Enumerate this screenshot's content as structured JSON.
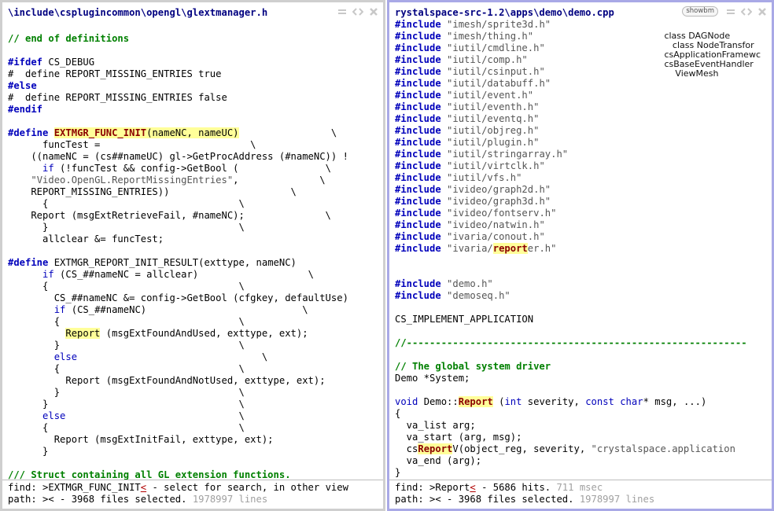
{
  "left": {
    "title": "\\include\\csplugincommon\\opengl\\glextmanager.h",
    "lines": [
      [],
      [
        {
          "t": "// end of definitions",
          "c": "cm"
        }
      ],
      [],
      [
        {
          "t": "#ifdef",
          "c": "pp"
        },
        {
          "t": " CS_DEBUG"
        }
      ],
      [
        {
          "t": "#  define REPORT_MISSING_ENTRIES true"
        }
      ],
      [
        {
          "t": "#else",
          "c": "pp"
        }
      ],
      [
        {
          "t": "#  define REPORT_MISSING_ENTRIES false"
        }
      ],
      [
        {
          "t": "#endif",
          "c": "pp"
        }
      ],
      [],
      [
        {
          "t": "#define",
          "c": "pp"
        },
        {
          "t": " "
        },
        {
          "t": "EXTMGR_FUNC_INIT",
          "c": "hlo"
        },
        {
          "t": "(nameNC, nameUC)",
          "c": "hl"
        },
        {
          "t": "                \\"
        }
      ],
      [
        {
          "t": "      funcTest =                          \\"
        }
      ],
      [
        {
          "t": "    ((nameNC = (cs##nameUC) gl->GetProcAddress (#nameNC)) !"
        }
      ],
      [
        {
          "t": "      "
        },
        {
          "t": "if",
          "c": "kw"
        },
        {
          "t": " (!funcTest && config->GetBool (               \\"
        }
      ],
      [
        {
          "t": "    "
        },
        {
          "t": "\"Video.OpenGL.ReportMissingEntries\"",
          "c": "str"
        },
        {
          "t": ",              \\"
        }
      ],
      [
        {
          "t": "    REPORT_MISSING_ENTRIES))                     \\"
        }
      ],
      [
        {
          "t": "      {                                 \\"
        }
      ],
      [
        {
          "t": "    Report (msgExtRetrieveFail, #nameNC);              \\"
        }
      ],
      [
        {
          "t": "      }                                 \\"
        }
      ],
      [
        {
          "t": "      allclear &= funcTest;"
        }
      ],
      [],
      [
        {
          "t": "#define",
          "c": "pp"
        },
        {
          "t": " EXTMGR_REPORT_INIT_RESULT(exttype, nameNC)"
        }
      ],
      [
        {
          "t": "      "
        },
        {
          "t": "if",
          "c": "kw"
        },
        {
          "t": " (CS_##nameNC = allclear)                   \\"
        }
      ],
      [
        {
          "t": "      {                                 \\"
        }
      ],
      [
        {
          "t": "        CS_##nameNC &= config->GetBool (cfgkey, defaultUse)"
        }
      ],
      [
        {
          "t": "        "
        },
        {
          "t": "if",
          "c": "kw"
        },
        {
          "t": " (CS_##nameNC)                           \\"
        }
      ],
      [
        {
          "t": "        {                               \\"
        }
      ],
      [
        {
          "t": "          "
        },
        {
          "t": "Report",
          "c": "hl"
        },
        {
          "t": " (msgExtFoundAndUsed, exttype, ext);"
        }
      ],
      [
        {
          "t": "        }                               \\"
        }
      ],
      [
        {
          "t": "        "
        },
        {
          "t": "else",
          "c": "kw"
        },
        {
          "t": "                                \\"
        }
      ],
      [
        {
          "t": "        {                               \\"
        }
      ],
      [
        {
          "t": "          Report (msgExtFoundAndNotUsed, exttype, ext);"
        }
      ],
      [
        {
          "t": "        }                               \\"
        }
      ],
      [
        {
          "t": "      }                                 \\"
        }
      ],
      [
        {
          "t": "      "
        },
        {
          "t": "else",
          "c": "kw"
        },
        {
          "t": "                              \\"
        }
      ],
      [
        {
          "t": "      {                                 \\"
        }
      ],
      [
        {
          "t": "        Report (msgExtInitFail, exttype, ext);"
        }
      ],
      [
        {
          "t": "      }"
        }
      ],
      [],
      [
        {
          "t": "/// Struct containing all GL extension functions.",
          "c": "cm"
        }
      ]
    ],
    "status": {
      "find_prefix": "find: >EXTMGR_FUNC_INIT",
      "find_caret": "<",
      "find_rest": " - select for search, in other view",
      "path_text": "path: >< - 3968 files selected. ",
      "path_count": "1978997 lines"
    }
  },
  "right": {
    "title": "rystalspace-src-1.2\\apps\\demo\\demo.cpp",
    "showbm": "showbm",
    "outline": [
      "class DAGNode",
      "   class NodeTransfor",
      "csApplicationFramewc",
      "csBaseEventHandler",
      "    ViewMesh"
    ],
    "lines": [
      [
        {
          "t": "#include",
          "c": "pp"
        },
        {
          "t": " "
        },
        {
          "t": "\"imesh/sprite3d.h\"",
          "c": "str"
        }
      ],
      [
        {
          "t": "#include",
          "c": "pp"
        },
        {
          "t": " "
        },
        {
          "t": "\"imesh/thing.h\"",
          "c": "str"
        }
      ],
      [
        {
          "t": "#include",
          "c": "pp"
        },
        {
          "t": " "
        },
        {
          "t": "\"iutil/cmdline.h\"",
          "c": "str"
        }
      ],
      [
        {
          "t": "#include",
          "c": "pp"
        },
        {
          "t": " "
        },
        {
          "t": "\"iutil/comp.h\"",
          "c": "str"
        }
      ],
      [
        {
          "t": "#include",
          "c": "pp"
        },
        {
          "t": " "
        },
        {
          "t": "\"iutil/csinput.h\"",
          "c": "str"
        }
      ],
      [
        {
          "t": "#include",
          "c": "pp"
        },
        {
          "t": " "
        },
        {
          "t": "\"iutil/databuff.h\"",
          "c": "str"
        }
      ],
      [
        {
          "t": "#include",
          "c": "pp"
        },
        {
          "t": " "
        },
        {
          "t": "\"iutil/event.h\"",
          "c": "str"
        }
      ],
      [
        {
          "t": "#include",
          "c": "pp"
        },
        {
          "t": " "
        },
        {
          "t": "\"iutil/eventh.h\"",
          "c": "str"
        }
      ],
      [
        {
          "t": "#include",
          "c": "pp"
        },
        {
          "t": " "
        },
        {
          "t": "\"iutil/eventq.h\"",
          "c": "str"
        }
      ],
      [
        {
          "t": "#include",
          "c": "pp"
        },
        {
          "t": " "
        },
        {
          "t": "\"iutil/objreg.h\"",
          "c": "str"
        }
      ],
      [
        {
          "t": "#include",
          "c": "pp"
        },
        {
          "t": " "
        },
        {
          "t": "\"iutil/plugin.h\"",
          "c": "str"
        }
      ],
      [
        {
          "t": "#include",
          "c": "pp"
        },
        {
          "t": " "
        },
        {
          "t": "\"iutil/stringarray.h\"",
          "c": "str"
        }
      ],
      [
        {
          "t": "#include",
          "c": "pp"
        },
        {
          "t": " "
        },
        {
          "t": "\"iutil/virtclk.h\"",
          "c": "str"
        }
      ],
      [
        {
          "t": "#include",
          "c": "pp"
        },
        {
          "t": " "
        },
        {
          "t": "\"iutil/vfs.h\"",
          "c": "str"
        }
      ],
      [
        {
          "t": "#include",
          "c": "pp"
        },
        {
          "t": " "
        },
        {
          "t": "\"ivideo/graph2d.h\"",
          "c": "str"
        }
      ],
      [
        {
          "t": "#include",
          "c": "pp"
        },
        {
          "t": " "
        },
        {
          "t": "\"ivideo/graph3d.h\"",
          "c": "str"
        }
      ],
      [
        {
          "t": "#include",
          "c": "pp"
        },
        {
          "t": " "
        },
        {
          "t": "\"ivideo/fontserv.h\"",
          "c": "str"
        }
      ],
      [
        {
          "t": "#include",
          "c": "pp"
        },
        {
          "t": " "
        },
        {
          "t": "\"ivideo/natwin.h\"",
          "c": "str"
        }
      ],
      [
        {
          "t": "#include",
          "c": "pp"
        },
        {
          "t": " "
        },
        {
          "t": "\"ivaria/conout.h\"",
          "c": "str"
        }
      ],
      [
        {
          "t": "#include",
          "c": "pp"
        },
        {
          "t": " "
        },
        {
          "t": "\"ivaria/",
          "c": "str"
        },
        {
          "t": "report",
          "c": "hlo"
        },
        {
          "t": "er.h\"",
          "c": "str"
        }
      ],
      [],
      [],
      [
        {
          "t": "#include",
          "c": "pp"
        },
        {
          "t": " "
        },
        {
          "t": "\"demo.h\"",
          "c": "str"
        }
      ],
      [
        {
          "t": "#include",
          "c": "pp"
        },
        {
          "t": " "
        },
        {
          "t": "\"demoseq.h\"",
          "c": "str"
        }
      ],
      [],
      [
        {
          "t": "CS_IMPLEMENT_APPLICATION"
        }
      ],
      [],
      [
        {
          "t": "//-----------------------------------------------------------",
          "c": "cm"
        }
      ],
      [],
      [
        {
          "t": "// The global system driver",
          "c": "cm"
        }
      ],
      [
        {
          "t": "Demo *System;"
        }
      ],
      [],
      [
        {
          "t": "void",
          "c": "kw"
        },
        {
          "t": " Demo::"
        },
        {
          "t": "Report",
          "c": "hlo"
        },
        {
          "t": " ("
        },
        {
          "t": "int",
          "c": "kw"
        },
        {
          "t": " severity, "
        },
        {
          "t": "const",
          "c": "kw"
        },
        {
          "t": " "
        },
        {
          "t": "char",
          "c": "kw"
        },
        {
          "t": "* msg, ...)"
        }
      ],
      [
        {
          "t": "{"
        }
      ],
      [
        {
          "t": "  va_list arg;"
        }
      ],
      [
        {
          "t": "  va_start (arg, msg);"
        }
      ],
      [
        {
          "t": "  cs"
        },
        {
          "t": "Report",
          "c": "hlo"
        },
        {
          "t": "V(object_reg, severity, "
        },
        {
          "t": "\"crystalspace.application",
          "c": "str"
        }
      ],
      [
        {
          "t": "  va_end (arg);"
        }
      ],
      [
        {
          "t": "}"
        }
      ]
    ],
    "status": {
      "find_prefix": "find: >Report",
      "find_caret": "<",
      "find_rest": " - 5686 hits. ",
      "find_time": "711 msec",
      "path_text": "path: >< - 3968 files selected. ",
      "path_count": "1978997 lines"
    }
  }
}
